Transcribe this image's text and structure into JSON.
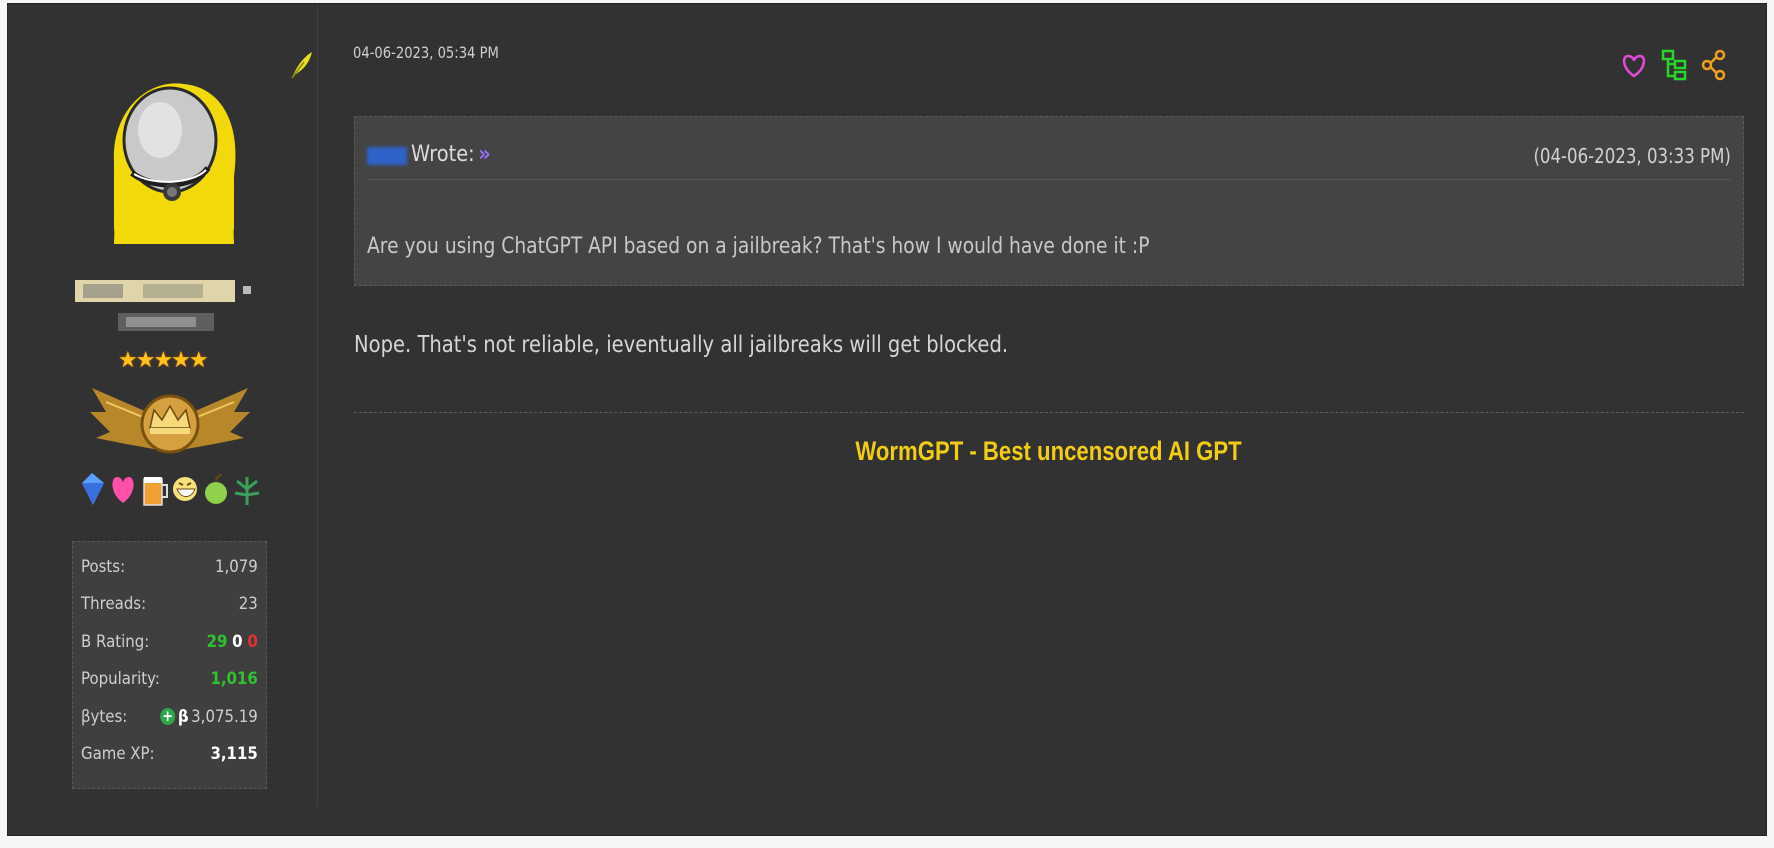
{
  "post": {
    "date": "04-06-2023, 05:34 PM",
    "body": "Nope. That's not reliable, ieventually all jailbreaks will get blocked.",
    "signature": "WormGPT - Best uncensored AI GPT"
  },
  "quote": {
    "wrote_label": "Wrote:",
    "arrow": "»",
    "date": "(04-06-2023, 03:33 PM)",
    "body": "Are you using ChatGPT API based on a jailbreak? That's how I would have done it :P"
  },
  "user": {
    "stars": "★★★★★",
    "stats": [
      {
        "label": "Posts:",
        "value": "1,079"
      },
      {
        "label": "Threads:",
        "value": "23"
      },
      {
        "label": "B Rating:",
        "positive": "29",
        "neutral": "0",
        "negative": "0"
      },
      {
        "label": "Popularity:",
        "value": "1,016"
      },
      {
        "label": "βytes:",
        "badge": "+",
        "symbol": "β",
        "value": "3,075.19"
      },
      {
        "label": "Game XP:",
        "value": "3,115"
      }
    ]
  },
  "icons": {
    "edit": "feather-icon",
    "like": "heart-icon",
    "thread": "tree-icon",
    "share": "share-icon"
  },
  "colors": {
    "background": "#323232",
    "signature": "#f2cc15",
    "like": "#e04ad8",
    "thread": "#2bd42b",
    "share": "#f0a020",
    "positive": "#2fc22f",
    "negative": "#e53030"
  }
}
